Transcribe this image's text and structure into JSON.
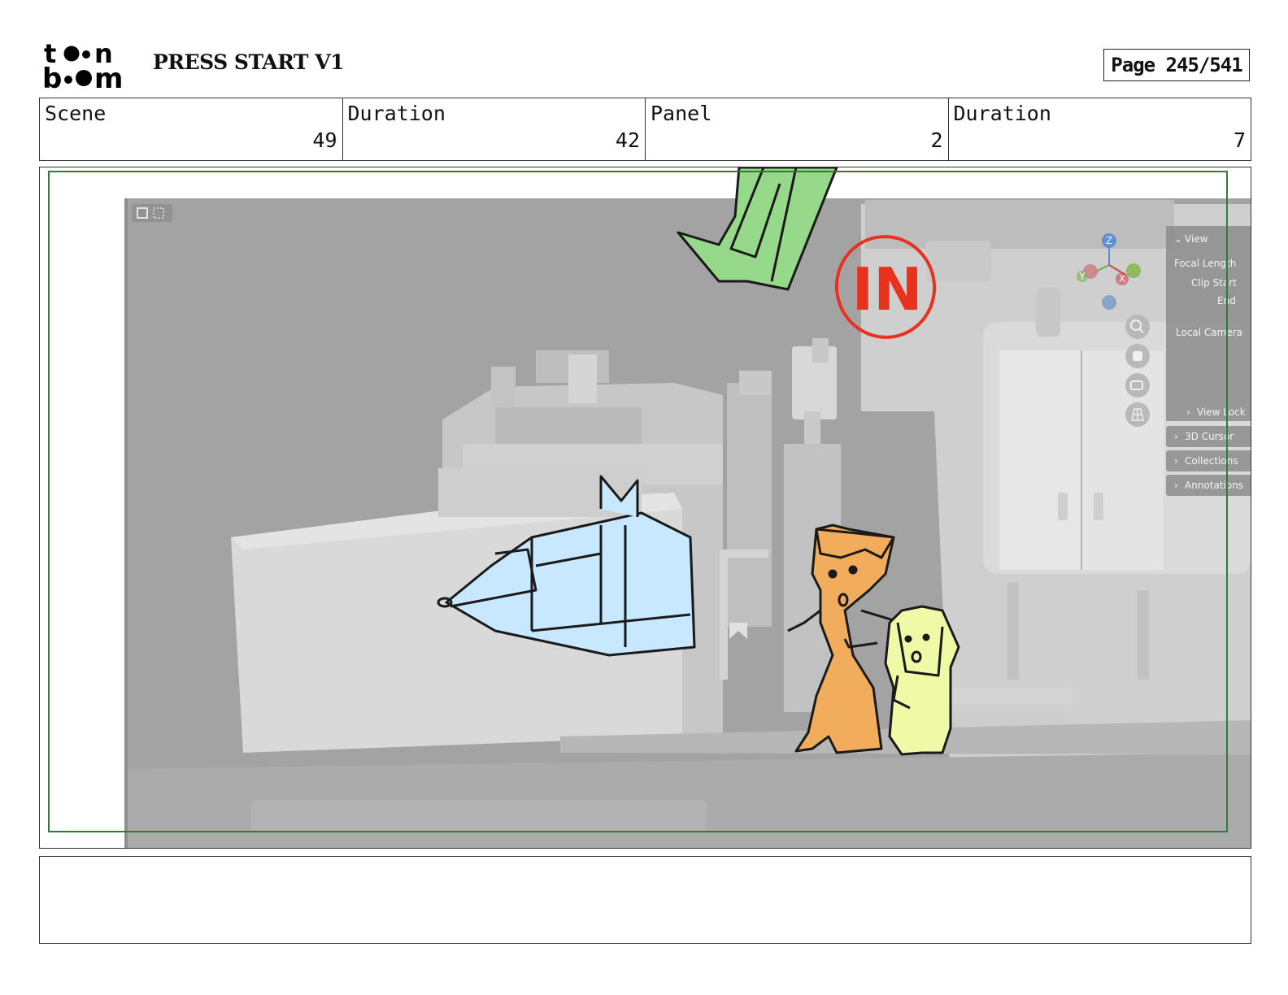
{
  "header": {
    "logo_text": "toon boom",
    "title": "PRESS START V1",
    "page_label": "Page 245/541"
  },
  "info": [
    {
      "label": "Scene",
      "value": "49"
    },
    {
      "label": "Duration",
      "value": "42"
    },
    {
      "label": "Panel",
      "value": "2"
    },
    {
      "label": "Duration",
      "value": "7"
    }
  ],
  "viewport": {
    "view_header": "View",
    "props": [
      "Focal Length",
      "Clip Start",
      "End",
      "Local Camera"
    ],
    "sections": [
      "View Lock",
      "3D Cursor",
      "Collections",
      "Annotations"
    ],
    "gizmo_axes": [
      "Z",
      "Y",
      "X"
    ]
  },
  "annotation": "IN",
  "caption": "",
  "colors": {
    "safe_frame": "#2f7d32",
    "cat_fill": "#c7e8ff",
    "girl_fill": "#f2ad5c",
    "kid_fill": "#eefaa6",
    "arrow_fill": "#96d98a",
    "annotation": "#e8321e"
  }
}
